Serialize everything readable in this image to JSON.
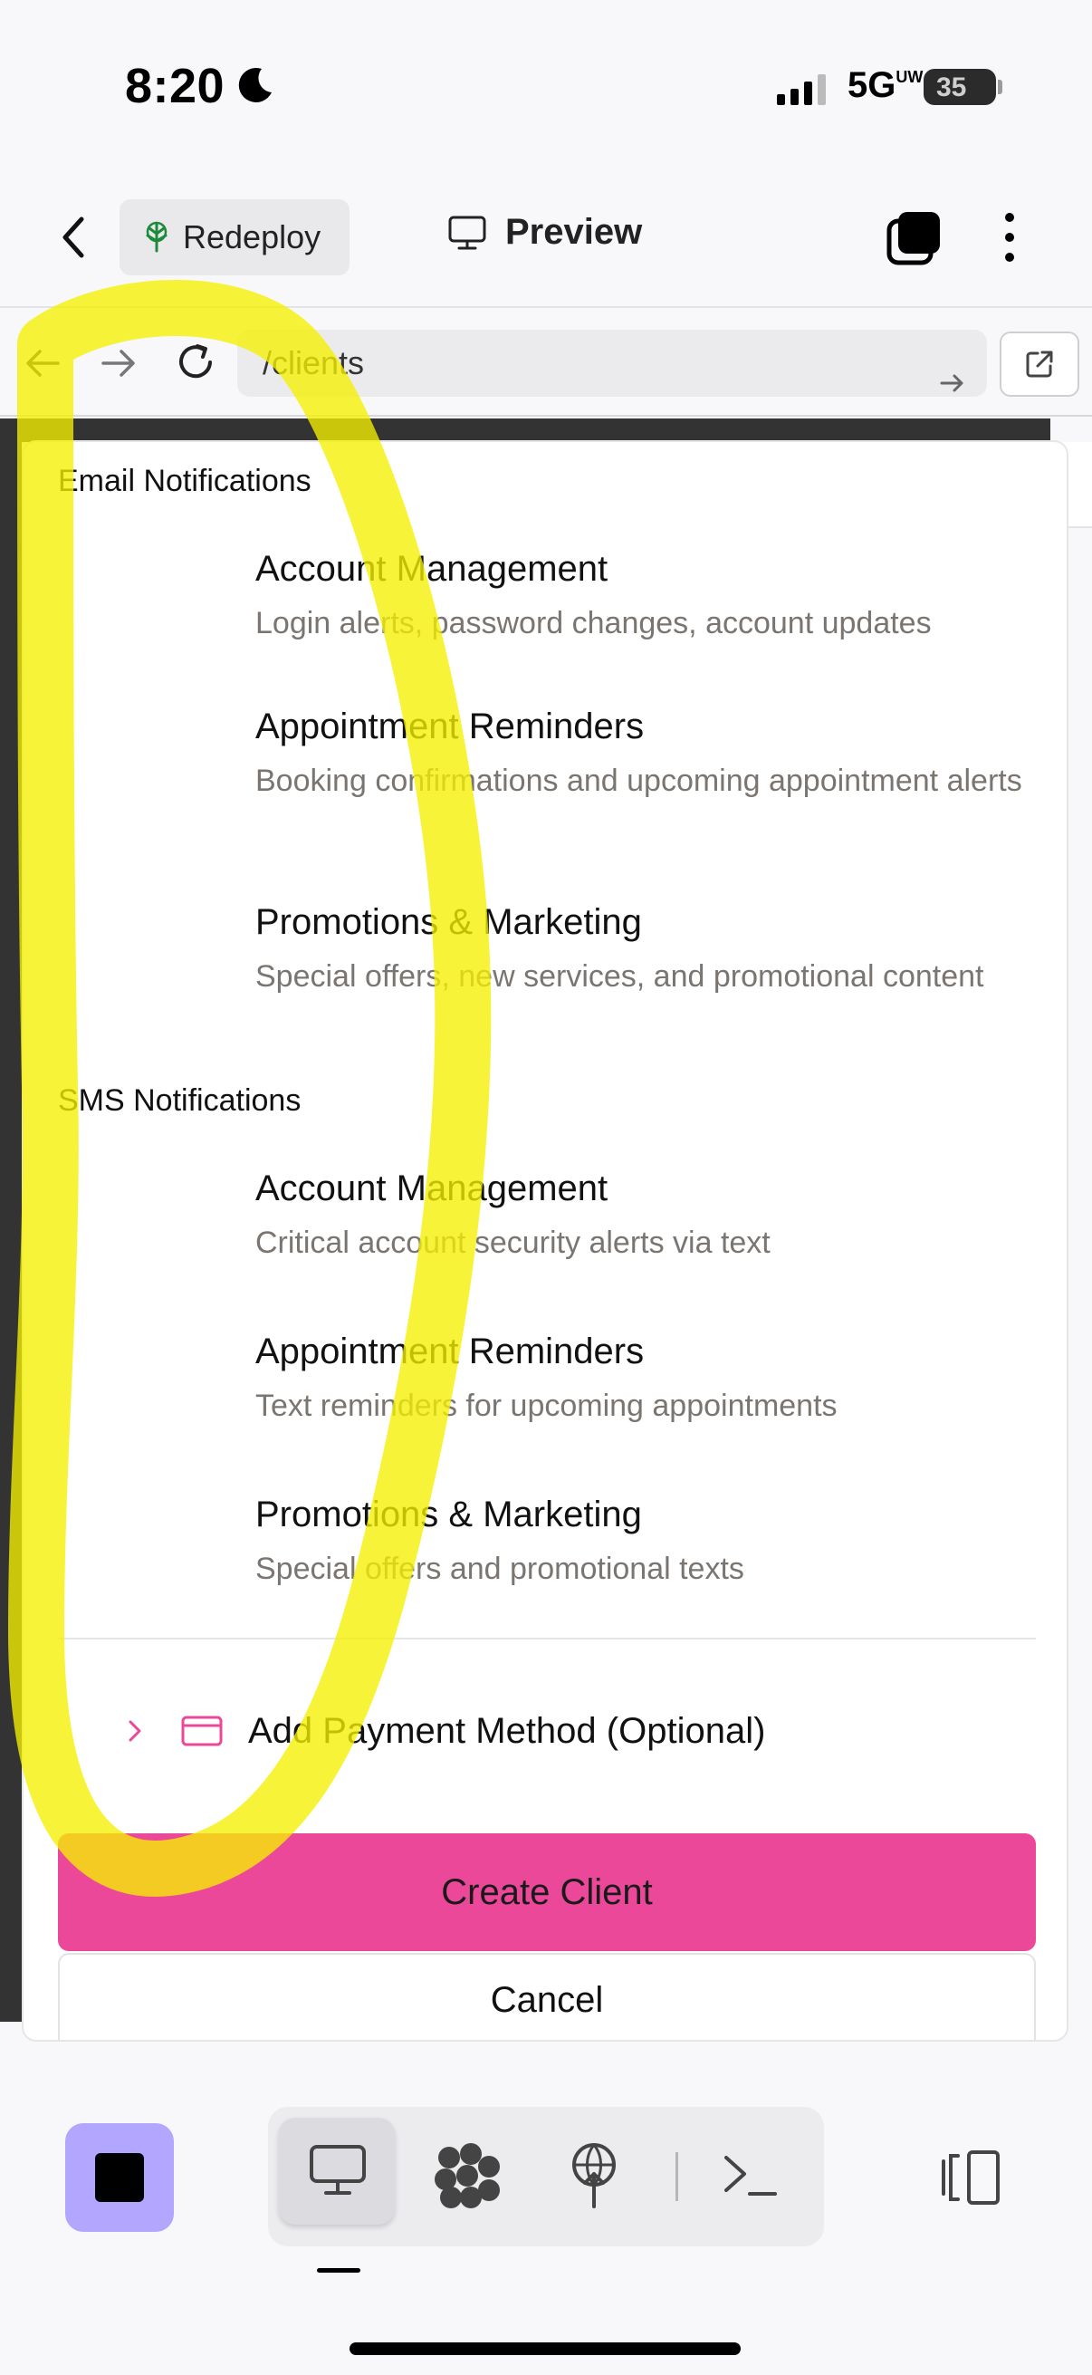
{
  "status_bar": {
    "time": "8:20",
    "network": "5G",
    "network_sup": "UW",
    "battery": "35"
  },
  "header": {
    "redeploy_label": "Redeploy",
    "preview_label": "Preview"
  },
  "url_bar": {
    "path": "/clients"
  },
  "email_notifications": {
    "heading": "Email Notifications",
    "items": [
      {
        "title": "Account Management",
        "description": "Login alerts, password changes, account updates"
      },
      {
        "title": "Appointment Reminders",
        "description": "Booking confirmations and upcoming appointment alerts"
      },
      {
        "title": "Promotions & Marketing",
        "description": "Special offers, new services, and promotional content"
      }
    ]
  },
  "sms_notifications": {
    "heading": "SMS Notifications",
    "items": [
      {
        "title": "Account Management",
        "description": "Critical account security alerts via text"
      },
      {
        "title": "Appointment Reminders",
        "description": "Text reminders for upcoming appointments"
      },
      {
        "title": "Promotions & Marketing",
        "description": "Special offers and promotional texts"
      }
    ]
  },
  "payment": {
    "label": "Add Payment Method (Optional)"
  },
  "actions": {
    "create_label": "Create Client",
    "cancel_label": "Cancel"
  },
  "colors": {
    "accent": "#ec4899",
    "stop_button": "#b3a6ff",
    "highlight": "#f5f000",
    "description_text": "#7a7571"
  },
  "icons": [
    "moon-icon",
    "back-icon",
    "tree-icon",
    "monitor-icon",
    "tabs-icon",
    "more-icon",
    "nav-back-icon",
    "nav-forward-icon",
    "reload-icon",
    "go-icon",
    "external-link-icon",
    "chevron-right-icon",
    "credit-card-icon",
    "stop-icon",
    "desktop-icon",
    "integrations-icon",
    "deploy-icon",
    "terminal-icon",
    "panel-toggle-icon"
  ]
}
